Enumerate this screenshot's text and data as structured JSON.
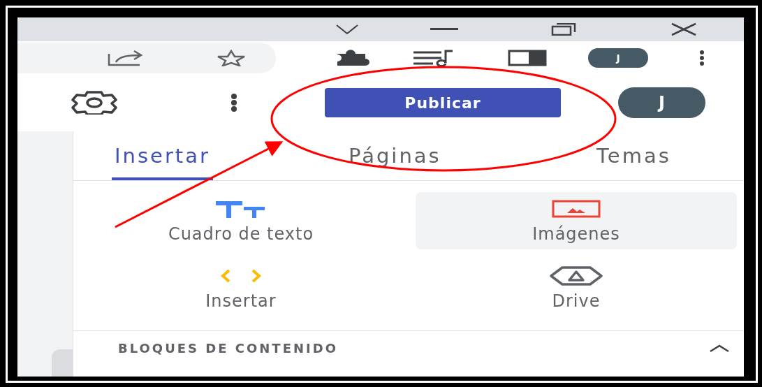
{
  "browser": {
    "profile_initial": "J"
  },
  "header": {
    "publish_button": "Publicar",
    "account_initial": "J"
  },
  "tabs": [
    {
      "label": "Insertar",
      "selected": true
    },
    {
      "label": "Páginas",
      "selected": false
    },
    {
      "label": "Temas",
      "selected": false
    }
  ],
  "insert_items": [
    {
      "label": "Cuadro de texto",
      "kind": "text",
      "highlighted": false
    },
    {
      "label": "Imágenes",
      "kind": "image",
      "highlighted": true
    },
    {
      "label": "Insertar",
      "kind": "embed",
      "highlighted": false
    },
    {
      "label": "Drive",
      "kind": "drive",
      "highlighted": false
    }
  ],
  "section": {
    "title": "BLOQUES DE CONTENIDO",
    "expanded": true
  }
}
